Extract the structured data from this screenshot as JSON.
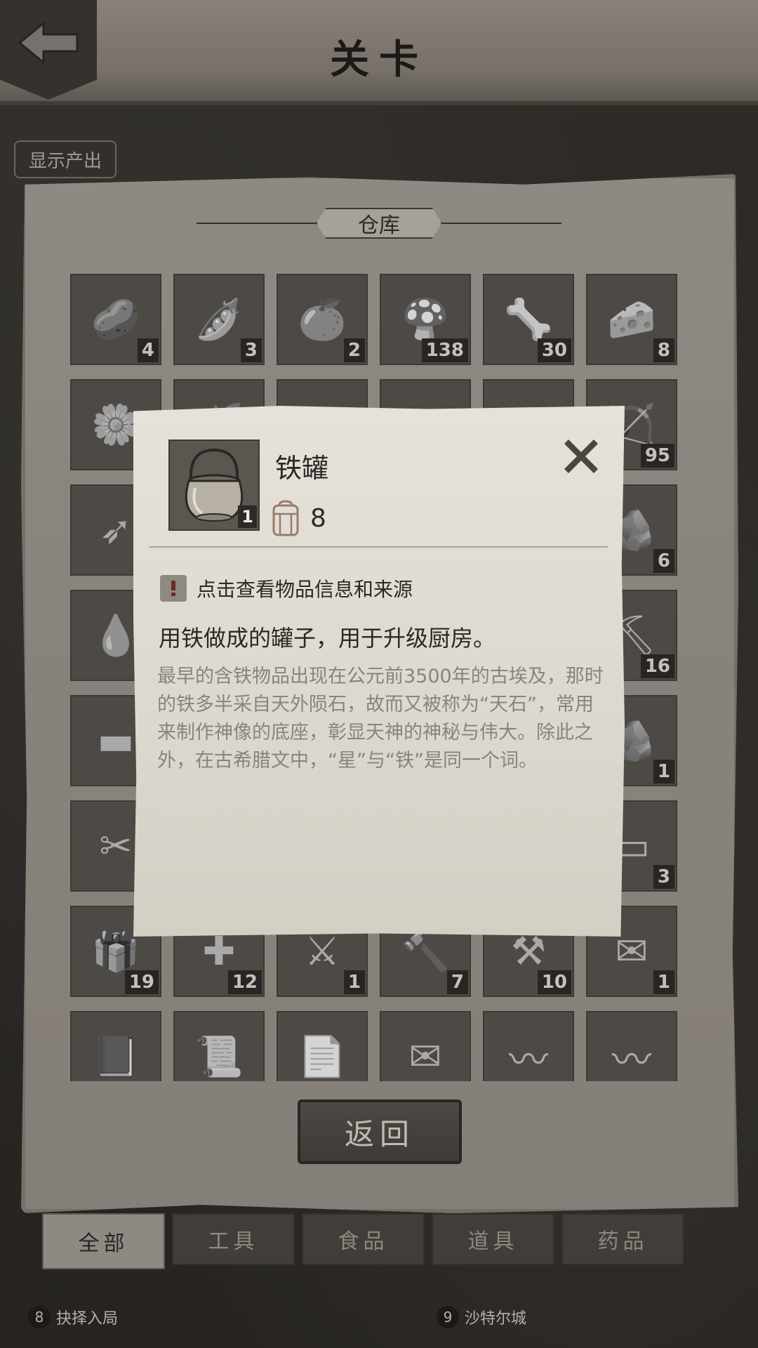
{
  "header": {
    "title": "关卡",
    "back_icon": "back-arrow-icon"
  },
  "toolbar": {
    "show_output_label": "显示产出"
  },
  "warehouse": {
    "title": "仓库",
    "items": [
      {
        "icon": "potato-icon",
        "glyph": "🥔",
        "count": "4"
      },
      {
        "icon": "peas-icon",
        "glyph": "🫛",
        "count": "3"
      },
      {
        "icon": "orange-icon",
        "glyph": "🍊",
        "count": "2"
      },
      {
        "icon": "mushroom-icon",
        "glyph": "🍄",
        "count": "138"
      },
      {
        "icon": "bone-icon",
        "glyph": "🦴",
        "count": "30"
      },
      {
        "icon": "cheese-slice-icon",
        "glyph": "🧀",
        "count": "8"
      },
      {
        "icon": "flower-icon",
        "glyph": "🌼",
        "count": ""
      },
      {
        "icon": "herb-icon",
        "glyph": "🌿",
        "count": ""
      },
      {
        "icon": "item-icon",
        "glyph": "",
        "count": ""
      },
      {
        "icon": "item-icon",
        "glyph": "",
        "count": ""
      },
      {
        "icon": "item-icon",
        "glyph": "",
        "count": ""
      },
      {
        "icon": "arrows-bundle-icon",
        "glyph": "🏹",
        "count": "95"
      },
      {
        "icon": "arrow-icon",
        "glyph": "➶",
        "count": ""
      },
      {
        "icon": "item-icon",
        "glyph": "",
        "count": ""
      },
      {
        "icon": "item-icon",
        "glyph": "",
        "count": ""
      },
      {
        "icon": "item-icon",
        "glyph": "",
        "count": ""
      },
      {
        "icon": "item-icon",
        "glyph": "",
        "count": ""
      },
      {
        "icon": "stone-block-icon",
        "glyph": "🪨",
        "count": "6"
      },
      {
        "icon": "liquid-icon",
        "glyph": "💧",
        "count": ""
      },
      {
        "icon": "item-icon",
        "glyph": "",
        "count": ""
      },
      {
        "icon": "item-icon",
        "glyph": "",
        "count": ""
      },
      {
        "icon": "item-icon",
        "glyph": "",
        "count": ""
      },
      {
        "icon": "item-icon",
        "glyph": "",
        "count": ""
      },
      {
        "icon": "coal-icon",
        "glyph": "⛏",
        "count": "16"
      },
      {
        "icon": "iron-bar-icon",
        "glyph": "▬",
        "count": ""
      },
      {
        "icon": "item-icon",
        "glyph": "",
        "count": ""
      },
      {
        "icon": "item-icon",
        "glyph": "",
        "count": ""
      },
      {
        "icon": "item-icon",
        "glyph": "",
        "count": ""
      },
      {
        "icon": "item-icon",
        "glyph": "",
        "count": ""
      },
      {
        "icon": "ore-icon",
        "glyph": "🪨",
        "count": "1"
      },
      {
        "icon": "tongs-icon",
        "glyph": "✂",
        "count": ""
      },
      {
        "icon": "item-icon",
        "glyph": "",
        "count": ""
      },
      {
        "icon": "item-icon",
        "glyph": "",
        "count": ""
      },
      {
        "icon": "item-icon",
        "glyph": "",
        "count": ""
      },
      {
        "icon": "item-icon",
        "glyph": "",
        "count": ""
      },
      {
        "icon": "plank-icon",
        "glyph": "▭",
        "count": "3"
      },
      {
        "icon": "food-box-icon",
        "glyph": "🎁",
        "count": "19"
      },
      {
        "icon": "medical-box-icon",
        "glyph": "✚",
        "count": "12"
      },
      {
        "icon": "weapon-box-icon",
        "glyph": "⚔",
        "count": "1"
      },
      {
        "icon": "tool-box-icon",
        "glyph": "🔨",
        "count": "7"
      },
      {
        "icon": "gear-box-icon",
        "glyph": "⚒",
        "count": "10"
      },
      {
        "icon": "sealed-letter-icon",
        "glyph": "✉",
        "count": "1"
      },
      {
        "icon": "book-icon",
        "glyph": "📕",
        "count": ""
      },
      {
        "icon": "scroll-icon",
        "glyph": "📜",
        "count": ""
      },
      {
        "icon": "paper-icon",
        "glyph": "📄",
        "count": ""
      },
      {
        "icon": "envelope-icon",
        "glyph": "✉",
        "count": ""
      },
      {
        "icon": "worm-icon",
        "glyph": "〰",
        "count": ""
      },
      {
        "icon": "whip-icon",
        "glyph": "〰",
        "count": ""
      }
    ],
    "return_label": "返回"
  },
  "tabs": [
    {
      "label": "全部",
      "active": true
    },
    {
      "label": "工具",
      "active": false
    },
    {
      "label": "食品",
      "active": false
    },
    {
      "label": "道具",
      "active": false
    },
    {
      "label": "药品",
      "active": false
    }
  ],
  "map": {
    "stage_8": {
      "num": "8",
      "name": "抉择入局"
    },
    "stage_9": {
      "num": "9",
      "name": "沙特尔城"
    }
  },
  "popup": {
    "item_name": "铁罐",
    "item_icon": "iron-pot-icon",
    "owned_count": "1",
    "bag_icon": "backpack-icon",
    "bag_value": "8",
    "hint_icon": "exclamation-icon",
    "hint_text": "点击查看物品信息和来源",
    "description": "用铁做成的罐子，用于升级厨房。",
    "lore": "最早的含铁物品出现在公元前3500年的古埃及，那时的铁多半采自天外陨石，故而又被称为“天石”，常用来制作神像的底座，彰显天神的神秘与伟大。除此之外，在古希腊文中，“星”与“铁”是同一个词。",
    "close_icon": "close-icon"
  }
}
